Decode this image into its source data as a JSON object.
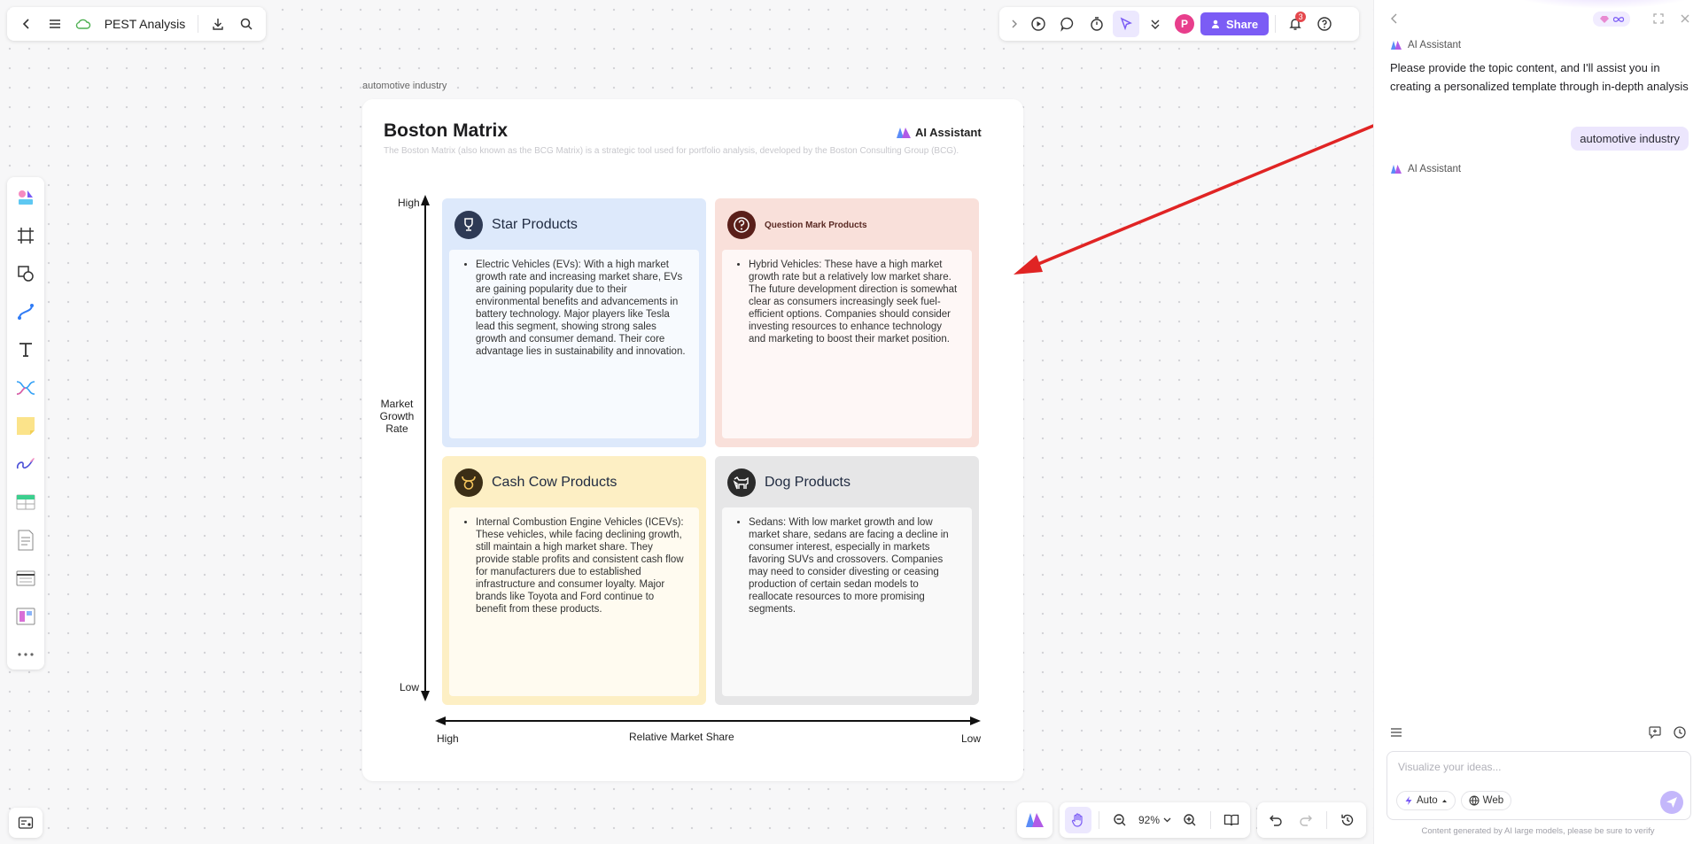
{
  "app": {
    "doc_title": "PEST Analysis"
  },
  "toolbar_right": {
    "share_label": "Share",
    "avatar_initial": "P",
    "notification_count": "3"
  },
  "canvas": {
    "frame_label": "automotive industry",
    "title": "Boston Matrix",
    "description": "The Boston Matrix (also known as the BCG Matrix) is a strategic tool used for portfolio analysis, developed by the Boston Consulting Group (BCG).",
    "brand": "AI Assistant",
    "y_axis": {
      "label": "Market Growth Rate",
      "high": "High",
      "low": "Low"
    },
    "x_axis": {
      "label": "Relative Market Share",
      "high": "High",
      "low": "Low"
    },
    "quadrants": {
      "star": {
        "title": "Star Products",
        "text": "Electric Vehicles (EVs): With a high market growth rate and increasing market share, EVs are gaining popularity due to their environmental benefits and advancements in battery technology. Major players like Tesla lead this segment, showing strong sales growth and consumer demand. Their core advantage lies in sustainability and innovation.",
        "color": "#dde9fb"
      },
      "question": {
        "title": "Question Mark Products",
        "text": "Hybrid Vehicles: These have a high market growth rate but a relatively low market share. The future development direction is somewhat clear as consumers increasingly seek fuel-efficient options. Companies should consider investing resources to enhance technology and marketing to boost their market position.",
        "color": "#f9e0da"
      },
      "cash_cow": {
        "title": "Cash Cow Products",
        "text": "Internal Combustion Engine Vehicles (ICEVs): These vehicles, while facing declining growth, still maintain a high market share. They provide stable profits and consistent cash flow for manufacturers due to established infrastructure and consumer loyalty. Major brands like Toyota and Ford continue to benefit from these products.",
        "color": "#fdefc4"
      },
      "dog": {
        "title": "Dog Products",
        "text": "Sedans: With low market growth and low market share, sedans are facing a decline in consumer interest, especially in markets favoring SUVs and crossovers. Companies may need to consider divesting or ceasing production of certain sedan models to reallocate resources to more promising segments.",
        "color": "#e6e6e7"
      }
    }
  },
  "bottom_bar": {
    "zoom": "92%"
  },
  "ai_panel": {
    "author": "AI Assistant",
    "assistant_message": "Please provide the topic content, and I'll assist you in creating a personalized template through in-depth analysis",
    "user_message": "automotive industry",
    "input_placeholder": "Visualize your ideas...",
    "mode_label": "Auto",
    "web_label": "Web",
    "disclaimer": "Content generated by AI large models, please be sure to verify"
  }
}
